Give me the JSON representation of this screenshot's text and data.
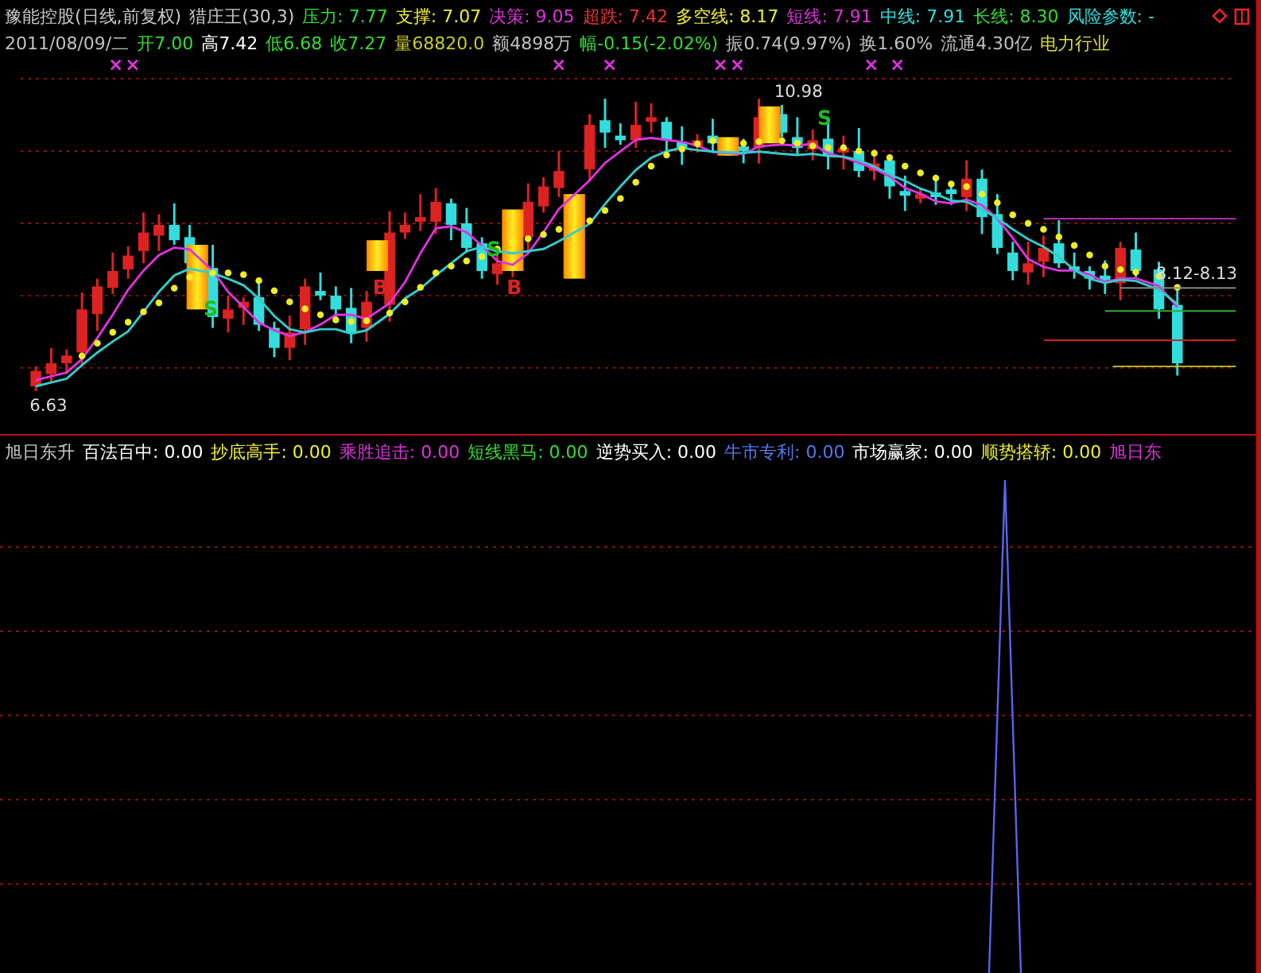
{
  "header": {
    "title": "豫能控股(日线,前复权)",
    "indicator": "猎庄王(30,3)",
    "values": [
      {
        "text": "压力: 7.77",
        "color": "#33dd33"
      },
      {
        "text": "支撑: 7.07",
        "color": "#eeee33"
      },
      {
        "text": "决策: 9.05",
        "color": "#dd33dd"
      },
      {
        "text": "超跌: 7.42",
        "color": "#ee3333"
      },
      {
        "text": "多空线: 8.17",
        "color": "#eeee33"
      },
      {
        "text": "短线: 7.91",
        "color": "#dd33dd"
      },
      {
        "text": "中线: 7.91",
        "color": "#33dddd"
      },
      {
        "text": "长线: 8.30",
        "color": "#33dd33"
      },
      {
        "text": "风险参数: -",
        "color": "#33dddd"
      }
    ]
  },
  "quote": [
    {
      "text": "2011/08/09/二",
      "color": "#c0c0c0"
    },
    {
      "text": "开7.00",
      "color": "#33dd33"
    },
    {
      "text": "高7.42",
      "color": "#ffffff"
    },
    {
      "text": "低6.68",
      "color": "#33dd33"
    },
    {
      "text": "收7.27",
      "color": "#33dd33"
    },
    {
      "text": "量68820.0",
      "color": "#c8c832"
    },
    {
      "text": "额4898万",
      "color": "#c0c0c0"
    },
    {
      "text": "幅-0.15(-2.02%)",
      "color": "#33dd33"
    },
    {
      "text": "振0.74(9.97%)",
      "color": "#c0c0c0"
    },
    {
      "text": "换1.60%",
      "color": "#c0c0c0"
    },
    {
      "text": "流通4.30亿",
      "color": "#c0c0c0"
    },
    {
      "text": "电力行业",
      "color": "#dddd33"
    }
  ],
  "main_chart": {
    "price_labels": [
      {
        "text": "10.98"
      },
      {
        "text": "6.63"
      },
      {
        "text": "8.12-8.13"
      }
    ],
    "signals": [
      {
        "text": "S",
        "kind": "sell"
      },
      {
        "text": "B",
        "kind": "buy"
      },
      {
        "text": "S",
        "kind": "sell"
      },
      {
        "text": "B",
        "kind": "buy"
      },
      {
        "text": "S",
        "kind": "sell"
      }
    ]
  },
  "indicator_panel": {
    "name": "旭日东升",
    "values": [
      {
        "text": "百法百中: 0.00",
        "color": "#ffffff"
      },
      {
        "text": "抄底高手: 0.00",
        "color": "#eeee33"
      },
      {
        "text": "乘胜追击: 0.00",
        "color": "#dd33dd"
      },
      {
        "text": "短线黑马: 0.00",
        "color": "#33dd33"
      },
      {
        "text": "逆势买入: 0.00",
        "color": "#ffffff"
      },
      {
        "text": "牛市专利: 0.00",
        "color": "#5577ee"
      },
      {
        "text": "市场赢家: 0.00",
        "color": "#ffffff"
      },
      {
        "text": "顺势搭轿: 0.00",
        "color": "#eeee33"
      },
      {
        "text": "旭日东",
        "color": "#dd33dd"
      }
    ]
  }
}
